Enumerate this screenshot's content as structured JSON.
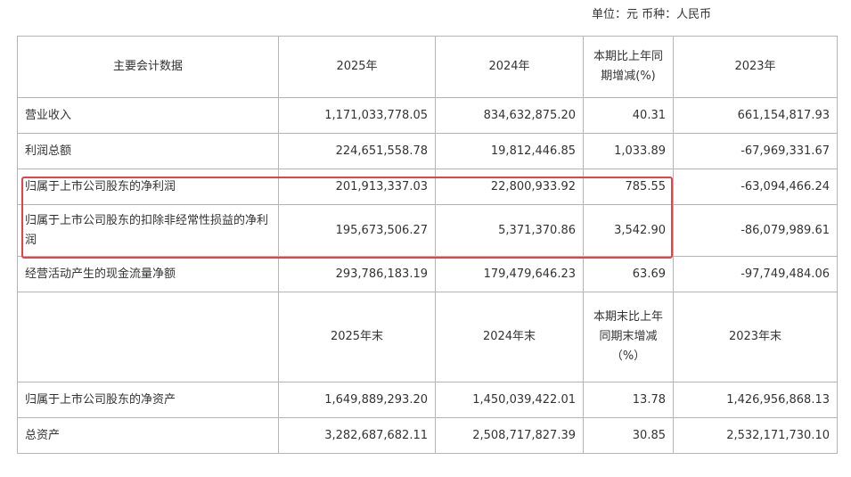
{
  "unit_line": "单位：元 币种：人民币",
  "header1": {
    "label": "主要会计数据",
    "col2025": "2025年",
    "col2024": "2024年",
    "change": "本期比上年同期增减(%)",
    "col2023": "2023年"
  },
  "rows1": [
    {
      "label": "营业收入",
      "v2025": "1,171,033,778.05",
      "v2024": "834,632,875.20",
      "change": "40.31",
      "v2023": "661,154,817.93"
    },
    {
      "label": "利润总额",
      "v2025": "224,651,558.78",
      "v2024": "19,812,446.85",
      "change": "1,033.89",
      "v2023": "-67,969,331.67"
    },
    {
      "label": "归属于上市公司股东的净利润",
      "v2025": "201,913,337.03",
      "v2024": "22,800,933.92",
      "change": "785.55",
      "v2023": "-63,094,466.24"
    },
    {
      "label": "归属于上市公司股东的扣除非经常性损益的净利润",
      "v2025": "195,673,506.27",
      "v2024": "5,371,370.86",
      "change": "3,542.90",
      "v2023": "-86,079,989.61"
    },
    {
      "label": "经营活动产生的现金流量净额",
      "v2025": "293,786,183.19",
      "v2024": "179,479,646.23",
      "change": "63.69",
      "v2023": "-97,749,484.06"
    }
  ],
  "header2": {
    "col2025": "2025年末",
    "col2024": "2024年末",
    "change": "本期末比上年同期末增减（%）",
    "col2023": "2023年末"
  },
  "rows2": [
    {
      "label": "归属于上市公司股东的净资产",
      "v2025": "1,649,889,293.20",
      "v2024": "1,450,039,422.01",
      "change": "13.78",
      "v2023": "1,426,956,868.13"
    },
    {
      "label": "总资产",
      "v2025": "3,282,687,682.11",
      "v2024": "2,508,717,827.39",
      "change": "30.85",
      "v2023": "2,532,171,730.10"
    }
  ],
  "highlight_color": "#e0454d"
}
